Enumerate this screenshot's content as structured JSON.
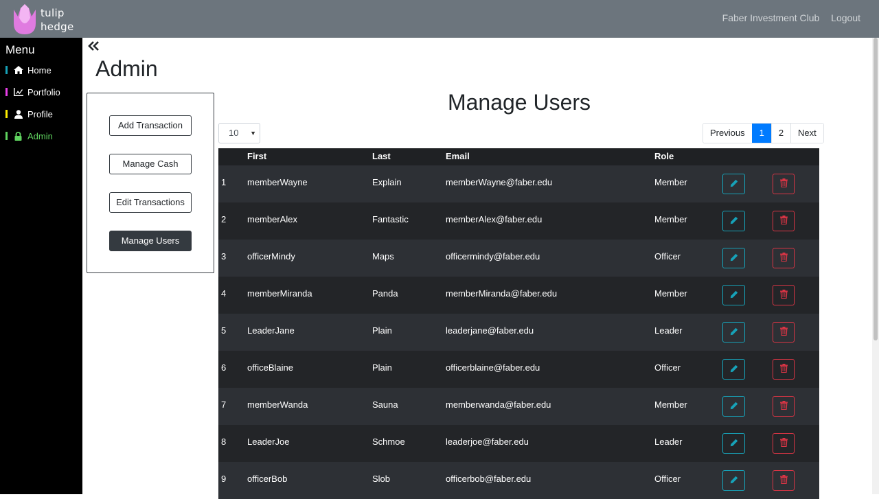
{
  "brand": {
    "line1": "tulip",
    "line2": "hedge",
    "logo_icon": "tulip-logo-icon"
  },
  "topnav": {
    "club": "Faber Investment Club",
    "logout": "Logout"
  },
  "sidebar": {
    "title": "Menu",
    "items": [
      {
        "label": "Home",
        "icon": "home-icon",
        "color": "#17a2b8"
      },
      {
        "label": "Portfolio",
        "icon": "chart-icon",
        "color": "#e83ee8"
      },
      {
        "label": "Profile",
        "icon": "user-icon",
        "color": "#ffee00"
      },
      {
        "label": "Admin",
        "icon": "lock-icon",
        "color": "#5fd35f"
      }
    ]
  },
  "page": {
    "title": "Admin",
    "collapse_icon": "double-chevron-left-icon"
  },
  "admin_panel": {
    "buttons": [
      "Add Transaction",
      "Manage Cash",
      "Edit Transactions",
      "Manage Users"
    ]
  },
  "users": {
    "title": "Manage Users",
    "page_size": "10",
    "pager": {
      "previous": "Previous",
      "pages": [
        "1",
        "2"
      ],
      "current": "1",
      "next": "Next"
    },
    "columns": [
      "First",
      "Last",
      "Email",
      "Role"
    ],
    "rows": [
      {
        "idx": "1",
        "first": "memberWayne",
        "last": "Explain",
        "email": "memberWayne@faber.edu",
        "role": "Member"
      },
      {
        "idx": "2",
        "first": "memberAlex",
        "last": "Fantastic",
        "email": "memberAlex@faber.edu",
        "role": "Member"
      },
      {
        "idx": "3",
        "first": "officerMindy",
        "last": "Maps",
        "email": "officermindy@faber.edu",
        "role": "Officer"
      },
      {
        "idx": "4",
        "first": "memberMiranda",
        "last": "Panda",
        "email": "memberMiranda@faber.edu",
        "role": "Member"
      },
      {
        "idx": "5",
        "first": "LeaderJane",
        "last": "Plain",
        "email": "leaderjane@faber.edu",
        "role": "Leader"
      },
      {
        "idx": "6",
        "first": "officeBlaine",
        "last": "Plain",
        "email": "officerblaine@faber.edu",
        "role": "Officer"
      },
      {
        "idx": "7",
        "first": "memberWanda",
        "last": "Sauna",
        "email": "memberwanda@faber.edu",
        "role": "Member"
      },
      {
        "idx": "8",
        "first": "LeaderJoe",
        "last": "Schmoe",
        "email": "leaderjoe@faber.edu",
        "role": "Leader"
      },
      {
        "idx": "9",
        "first": "officerBob",
        "last": "Slob",
        "email": "officerbob@faber.edu",
        "role": "Officer"
      }
    ],
    "edit_icon": "pencil-icon",
    "delete_icon": "trash-icon"
  },
  "colors": {
    "topbar": "#6c757d",
    "sidebar": "#000000",
    "primary": "#007bff",
    "edit": "#17a2b8",
    "delete": "#dc3545"
  }
}
